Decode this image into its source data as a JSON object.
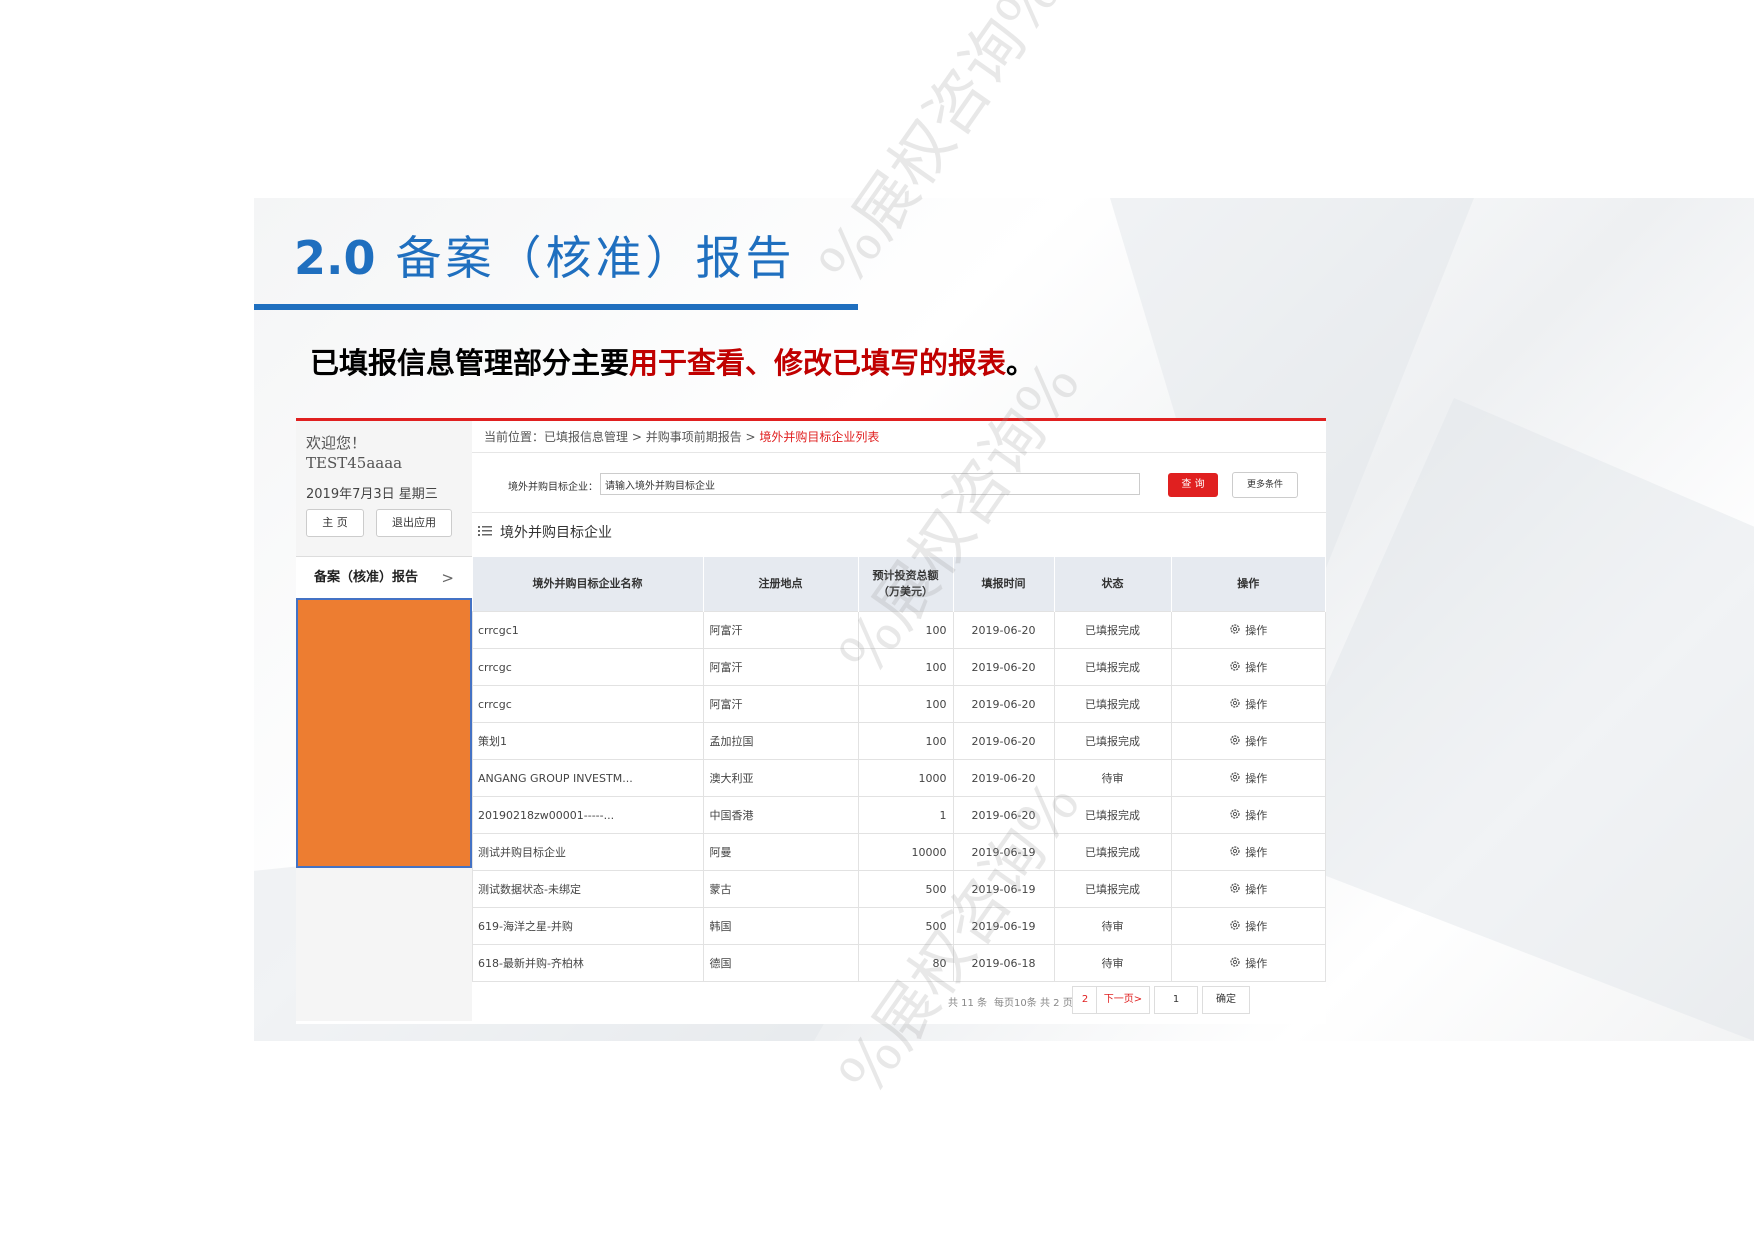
{
  "slide": {
    "title_number": "2.0",
    "title_text": "备案（核准）报告",
    "subtitle_black": "已填报信息管理部分主要",
    "subtitle_red": "用于查看、修改已填写的报表",
    "subtitle_end": "。"
  },
  "sidebar": {
    "welcome": "欢迎您！",
    "username": "TEST45aaaa",
    "date": "2019年7月3日 星期三",
    "home_button": "主 页",
    "logout_button": "退出应用",
    "menu_item": "备案（核准）报告",
    "menu_chevron": ">"
  },
  "breadcrumb": {
    "prefix": "当前位置：",
    "path": "已填报信息管理 > 并购事项前期报告 > ",
    "current": "境外并购目标企业列表"
  },
  "search": {
    "label": "境外并购目标企业：",
    "placeholder": "请输入境外并购目标企业",
    "query_button": "查 询",
    "more_button": "更多条件"
  },
  "section_title": "境外并购目标企业",
  "table": {
    "headers": [
      "境外并购目标企业名称",
      "注册地点",
      "预计投资总额（万美元）",
      "填报时间",
      "状态",
      "操作"
    ],
    "header_amount_line1": "预计投资总额",
    "header_amount_line2": "（万美元）",
    "rows": [
      {
        "name": "crrcgc1",
        "place": "阿富汗",
        "amount": "100",
        "date": "2019-06-20",
        "status": "已填报完成",
        "op": "操作"
      },
      {
        "name": "crrcgc",
        "place": "阿富汗",
        "amount": "100",
        "date": "2019-06-20",
        "status": "已填报完成",
        "op": "操作"
      },
      {
        "name": "crrcgc",
        "place": "阿富汗",
        "amount": "100",
        "date": "2019-06-20",
        "status": "已填报完成",
        "op": "操作"
      },
      {
        "name": "策划1",
        "place": "孟加拉国",
        "amount": "100",
        "date": "2019-06-20",
        "status": "已填报完成",
        "op": "操作"
      },
      {
        "name": "ANGANG GROUP INVESTM...",
        "place": "澳大利亚",
        "amount": "1000",
        "date": "2019-06-20",
        "status": "待审",
        "op": "操作"
      },
      {
        "name": "20190218zw00001-----...",
        "place": "中国香港",
        "amount": "1",
        "date": "2019-06-20",
        "status": "已填报完成",
        "op": "操作"
      },
      {
        "name": "测试并购目标企业",
        "place": "阿曼",
        "amount": "10000",
        "date": "2019-06-19",
        "status": "已填报完成",
        "op": "操作"
      },
      {
        "name": "测试数据状态-未绑定",
        "place": "蒙古",
        "amount": "500",
        "date": "2019-06-19",
        "status": "已填报完成",
        "op": "操作"
      },
      {
        "name": "619-海洋之星-并购",
        "place": "韩国",
        "amount": "500",
        "date": "2019-06-19",
        "status": "待审",
        "op": "操作"
      },
      {
        "name": "618-最新并购-齐柏林",
        "place": "德国",
        "amount": "80",
        "date": "2019-06-18",
        "status": "待审",
        "op": "操作"
      }
    ]
  },
  "pager": {
    "total": "共 11 条",
    "per_page": "每页10条",
    "pages": "共 2 页",
    "page_link": "2",
    "next": "下一页>",
    "page_input": "1",
    "confirm": "确定"
  },
  "watermark": "%展权咨询%",
  "colors": {
    "brand_blue": "#1f6fbf",
    "accent_red": "#e02020",
    "highlight_orange": "#ed7d31"
  }
}
